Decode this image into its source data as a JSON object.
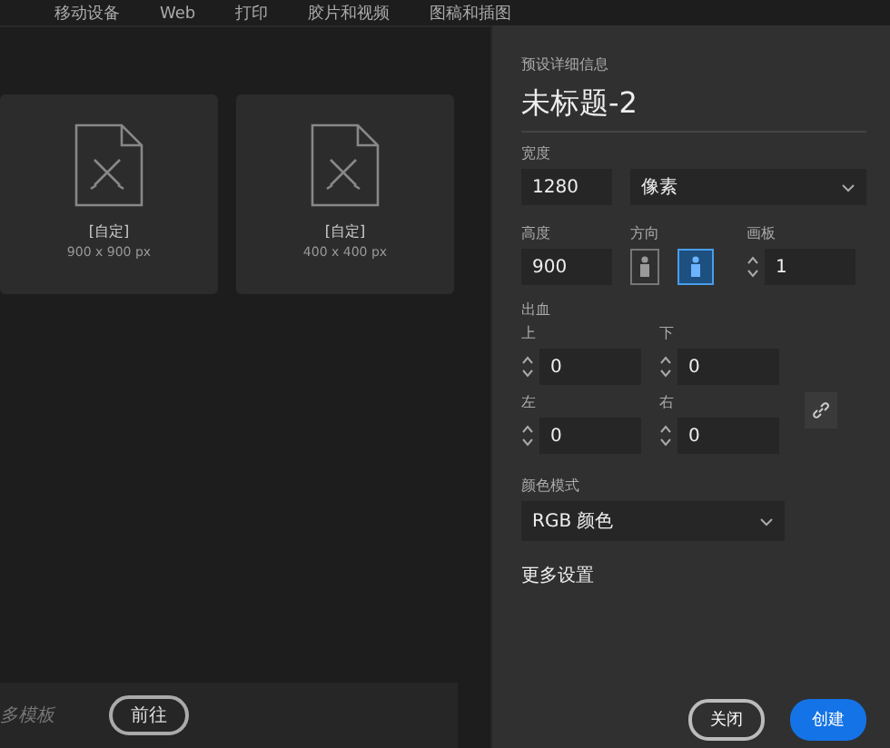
{
  "tabs": [
    {
      "label": "移动设备"
    },
    {
      "label": "Web"
    },
    {
      "label": "打印"
    },
    {
      "label": "胶片和视频"
    },
    {
      "label": "图稿和插图"
    }
  ],
  "presets": [
    {
      "name": "[自定]",
      "size": "900 x 900 px"
    },
    {
      "name": "[自定]",
      "size": "400 x 400 px"
    }
  ],
  "template_bar": {
    "text": "多模板",
    "button": "前往"
  },
  "details": {
    "heading": "预设详细信息",
    "title": "未标题-2",
    "width": {
      "label": "宽度",
      "value": "1280"
    },
    "unit": {
      "value": "像素"
    },
    "height": {
      "label": "高度",
      "value": "900"
    },
    "orientation": {
      "label": "方向",
      "options": [
        {
          "kind": "portrait",
          "selected": false
        },
        {
          "kind": "landscape",
          "selected": true
        }
      ]
    },
    "artboards": {
      "label": "画板",
      "value": "1"
    },
    "bleed": {
      "label": "出血",
      "fields": [
        {
          "label": "上",
          "value": "0"
        },
        {
          "label": "下",
          "value": "0"
        },
        {
          "label": "左",
          "value": "0"
        },
        {
          "label": "右",
          "value": "0"
        }
      ]
    },
    "color_mode": {
      "label": "颜色模式",
      "value": "RGB 颜色"
    },
    "more": "更多设置",
    "buttons": [
      {
        "label": "关闭",
        "kind": "secondary"
      },
      {
        "label": "创建",
        "kind": "primary"
      }
    ]
  }
}
